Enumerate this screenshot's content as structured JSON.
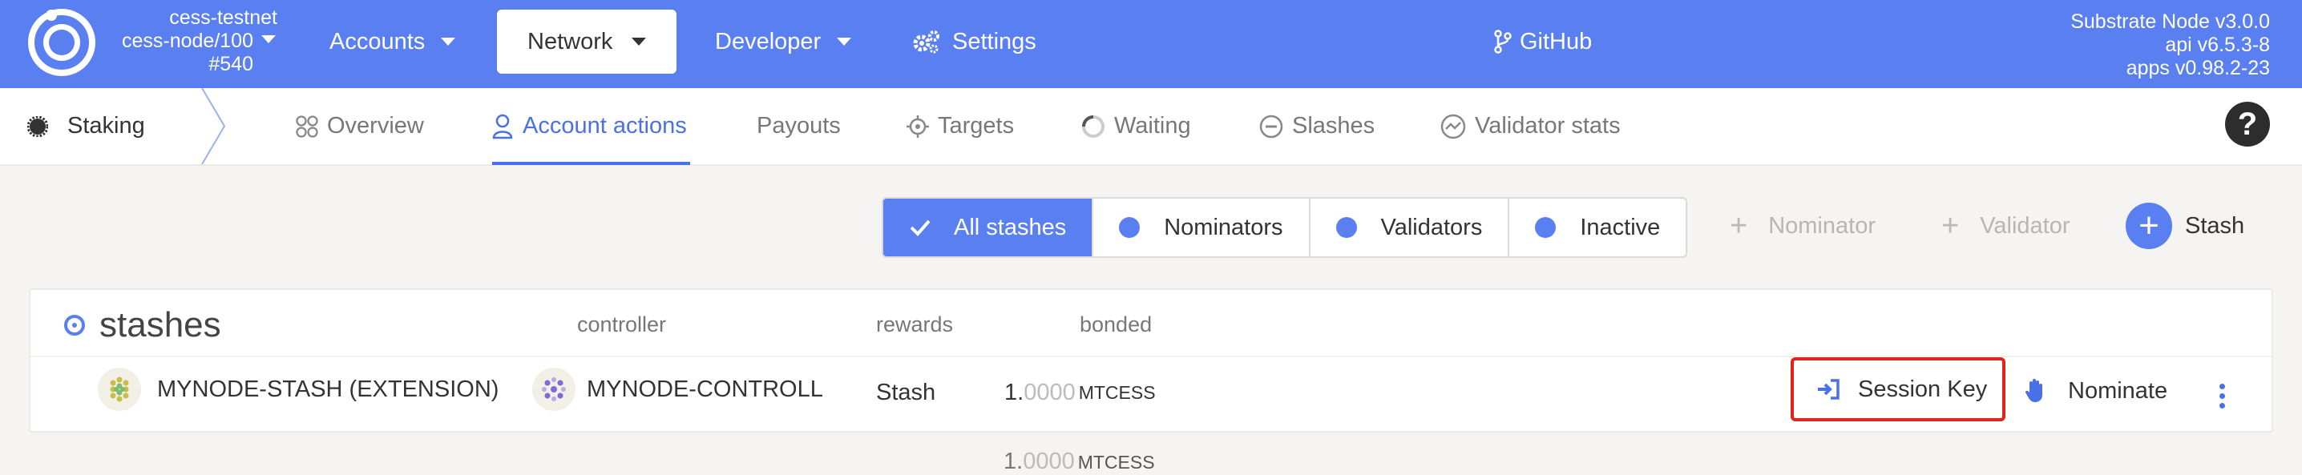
{
  "header": {
    "chain_name": "cess-testnet",
    "chain_node": "cess-node/100",
    "chain_block": "#540",
    "menu": {
      "accounts": "Accounts",
      "network": "Network",
      "developer": "Developer",
      "settings": "Settings",
      "github": "GitHub"
    },
    "node_info": {
      "line1": "Substrate Node v3.0.0",
      "line2": "api v6.5.3-8",
      "line3": "apps v0.98.2-23"
    }
  },
  "tabs": {
    "section": "Staking",
    "items": [
      "Overview",
      "Account actions",
      "Payouts",
      "Targets",
      "Waiting",
      "Slashes",
      "Validator stats"
    ],
    "active": "Account actions",
    "help": "?"
  },
  "filters": {
    "options": [
      "All stashes",
      "Nominators",
      "Validators",
      "Inactive"
    ],
    "selected": "All stashes"
  },
  "actions": {
    "nominator": "Nominator",
    "validator": "Validator",
    "stash": "Stash"
  },
  "table": {
    "title": "stashes",
    "headers": {
      "controller": "controller",
      "rewards": "rewards",
      "bonded": "bonded"
    },
    "row": {
      "stash": "MYNODE-STASH (EXTENSION)",
      "controller": "MYNODE-CONTROLL",
      "rewards": "Stash",
      "bonded_int": "1.",
      "bonded_dec": "0000",
      "bonded_unit": "MTCESS",
      "session_key": "Session Key",
      "nominate": "Nominate"
    },
    "total": {
      "int": "1.",
      "dec": "0000",
      "unit": "MTCESS"
    }
  },
  "colors": {
    "brand": "#5a7ff0",
    "accent": "#4a70e8",
    "highlight_border": "#e0231b"
  }
}
